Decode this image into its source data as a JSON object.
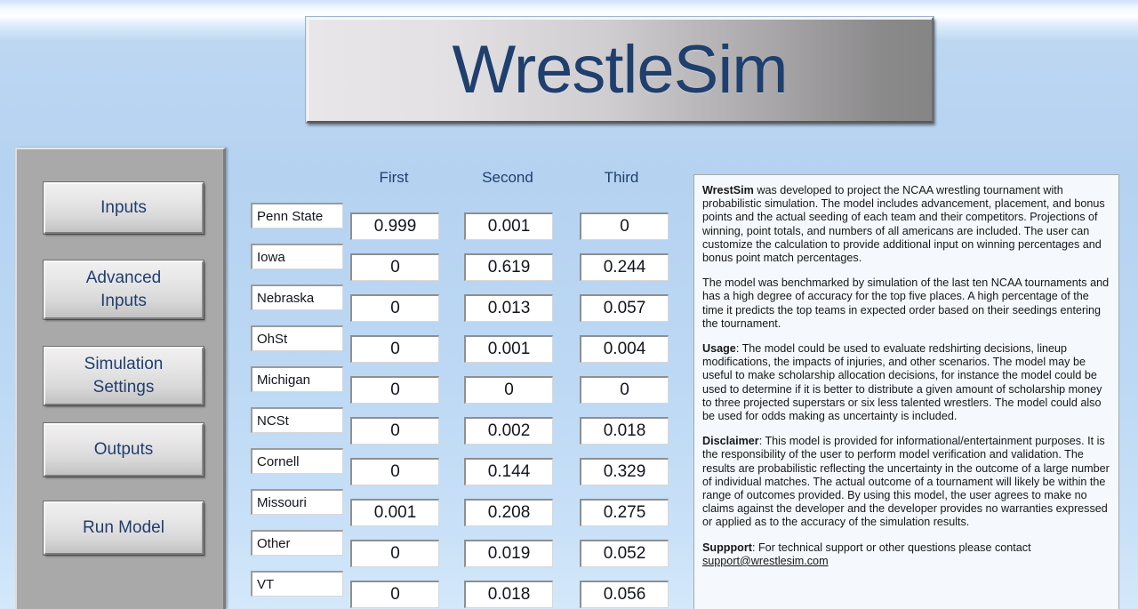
{
  "app": {
    "title": "WrestleSim"
  },
  "sidebar": {
    "items": [
      {
        "id": "inputs",
        "label": "Inputs"
      },
      {
        "id": "advanced",
        "label": "Advanced\nInputs"
      },
      {
        "id": "simset",
        "label": "Simulation\nSettings"
      },
      {
        "id": "outputs",
        "label": "Outputs"
      },
      {
        "id": "run",
        "label": "Run Model"
      }
    ]
  },
  "results_table": {
    "columns": [
      "First",
      "Second",
      "Third"
    ],
    "rows": [
      {
        "team": "Penn State",
        "values": [
          "0.999",
          "0.001",
          "0"
        ]
      },
      {
        "team": "Iowa",
        "values": [
          "0",
          "0.619",
          "0.244"
        ]
      },
      {
        "team": "Nebraska",
        "values": [
          "0",
          "0.013",
          "0.057"
        ]
      },
      {
        "team": "OhSt",
        "values": [
          "0",
          "0.001",
          "0.004"
        ]
      },
      {
        "team": "Michigan",
        "values": [
          "0",
          "0",
          "0"
        ]
      },
      {
        "team": "NCSt",
        "values": [
          "0",
          "0.002",
          "0.018"
        ]
      },
      {
        "team": "Cornell",
        "values": [
          "0",
          "0.144",
          "0.329"
        ]
      },
      {
        "team": "Missouri",
        "values": [
          "0.001",
          "0.208",
          "0.275"
        ]
      },
      {
        "team": "Other",
        "values": [
          "0",
          "0.019",
          "0.052"
        ]
      },
      {
        "team": "VT",
        "values": [
          "0",
          "0.018",
          "0.056"
        ]
      }
    ]
  },
  "description": {
    "p1_bold": "WrestSim",
    "p1_rest": " was developed to project the NCAA wrestling tournament with probabilistic simulation.  The model includes advancement, placement, and bonus points and the actual seeding of each team and their competitors.  Projections of winning, point totals, and numbers of all americans are included.  The user can customize the calculation to provide additional input on winning percentages and bonus point match percentages.",
    "p2": "The model was benchmarked by simulation of the last ten NCAA tournaments and has a high degree of accuracy for the top five places.  A high percentage of the time it predicts the top teams in expected order based on their seedings entering the tournament.",
    "p3_bold": "Usage",
    "p3_rest": ":  The model could be used to evaluate redshirting decisions, lineup modifications, the impacts of injuries, and other scenarios.  The model may be useful to make scholarship allocation decisions, for instance the model could be used to determine if it is better to distribute a given amount of scholarship money to three projected superstars or six less talented wrestlers.  The model could also be used for odds making as uncertainty is included.",
    "p4_bold": "Disclaimer",
    "p4_rest": ":  This model is provided for informational/entertainment purposes.  It is the responsibility of the user to perform model verification and validation.  The results are probabilistic reflecting the uncertainty in the outcome of a large number of individual matches.  The actual outcome of a tournament will likely be within the range of outcomes provided.  By using this model, the user agrees to make no claims against the developer and the developer provides no warranties expressed or applied as to the accuracy of the simulation results.",
    "p5_bold": "Suppport",
    "p5_rest": ":  For technical support or other questions please contact ",
    "p5_email": "support@wrestlesim.com "
  },
  "colors": {
    "accent_text": "#1f3f6e",
    "panel_bg": "#f5f9fd",
    "sidebar_bg": "#a9a9a9"
  }
}
